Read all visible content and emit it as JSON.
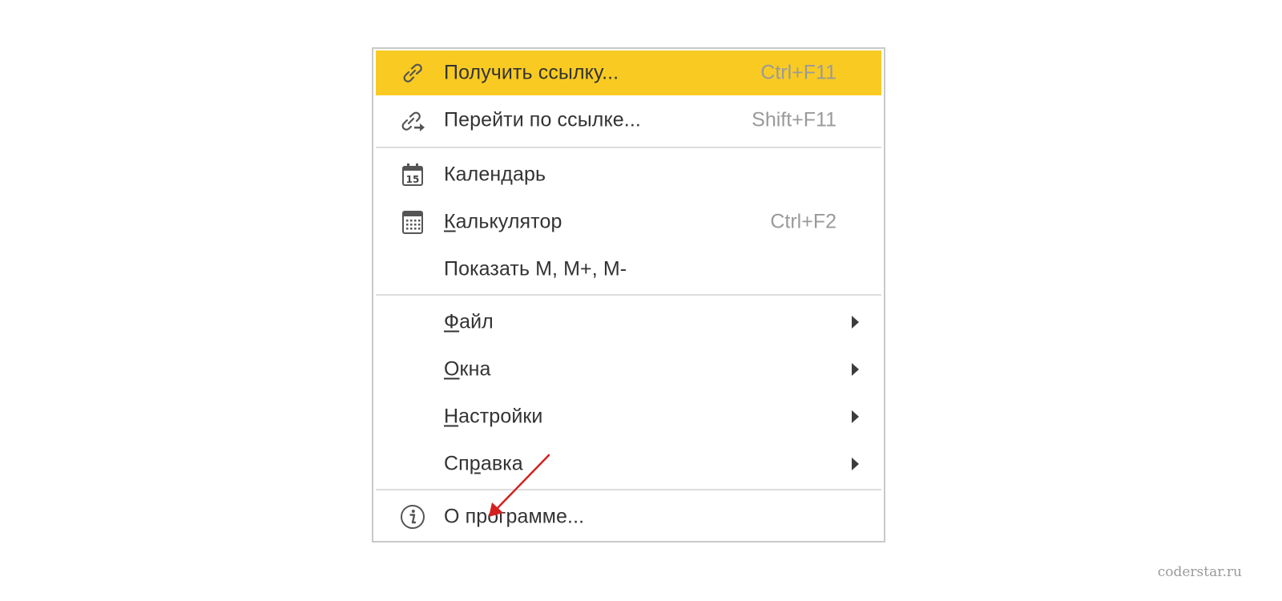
{
  "menu": {
    "items": [
      {
        "label_pre": "Получить ссылку...",
        "label_u": "",
        "label_post": "",
        "shortcut": "Ctrl+F11",
        "icon": "link-icon"
      },
      {
        "label_pre": "Перейти по ссылке...",
        "label_u": "",
        "label_post": "",
        "shortcut": "Shift+F11",
        "icon": "follow-link-icon"
      },
      {
        "label_pre": "Кален",
        "label_u": "д",
        "label_post": "арь",
        "shortcut": "",
        "icon": "calendar-icon",
        "icon_text": "15"
      },
      {
        "label_pre": "",
        "label_u": "К",
        "label_post": "алькулятор",
        "shortcut": "Ctrl+F2",
        "icon": "calculator-icon"
      },
      {
        "label_pre": "Показать М, М+, М-",
        "label_u": "",
        "label_post": "",
        "shortcut": ""
      },
      {
        "label_pre": "",
        "label_u": "Ф",
        "label_post": "айл",
        "submenu": true
      },
      {
        "label_pre": "",
        "label_u": "О",
        "label_post": "кна",
        "submenu": true
      },
      {
        "label_pre": "",
        "label_u": "Н",
        "label_post": "астройки",
        "submenu": true
      },
      {
        "label_pre": "Сп",
        "label_u": "р",
        "label_post": "авка",
        "submenu": true
      },
      {
        "label_pre": "О программе...",
        "label_u": "",
        "label_post": "",
        "icon": "info-icon"
      }
    ]
  },
  "watermark": "coderstar.ru",
  "colors": {
    "highlight": "#f9cb22",
    "text": "#333333",
    "shortcut": "#9a9a9a",
    "annotation_arrow": "#d42020"
  },
  "annotation": {
    "type": "arrow",
    "points_to": "about-menu-item"
  }
}
